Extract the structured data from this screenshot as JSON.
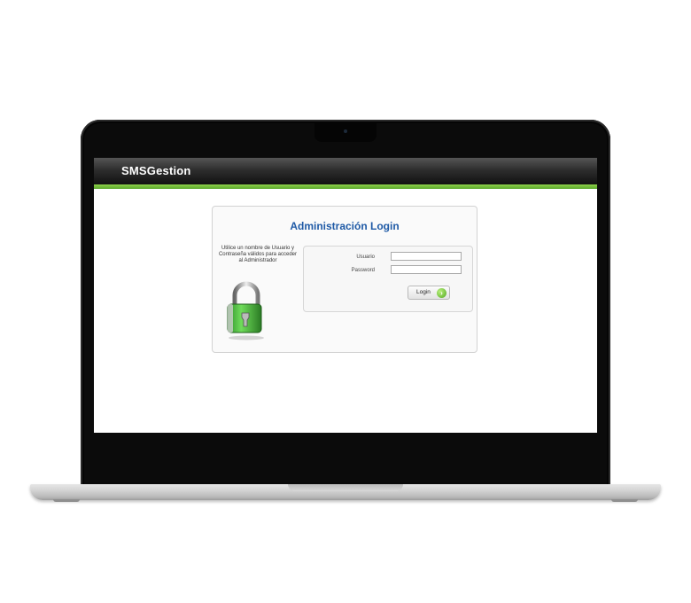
{
  "app": {
    "title": "SMSGestion"
  },
  "login": {
    "title": "Administración Login",
    "help_text": "Utilice un nombre de Usuario y Contraseña válidos para acceder al Administrador",
    "username_label": "Usuario",
    "password_label": "Password",
    "username_value": "",
    "password_value": "",
    "submit_label": "Login"
  },
  "icons": {
    "padlock": "padlock-icon",
    "login_arrow": "arrow-right-icon"
  },
  "colors": {
    "header_bg": "#1a1a1a",
    "accent_green": "#6fbf3a",
    "title_blue": "#1f5aa6"
  }
}
